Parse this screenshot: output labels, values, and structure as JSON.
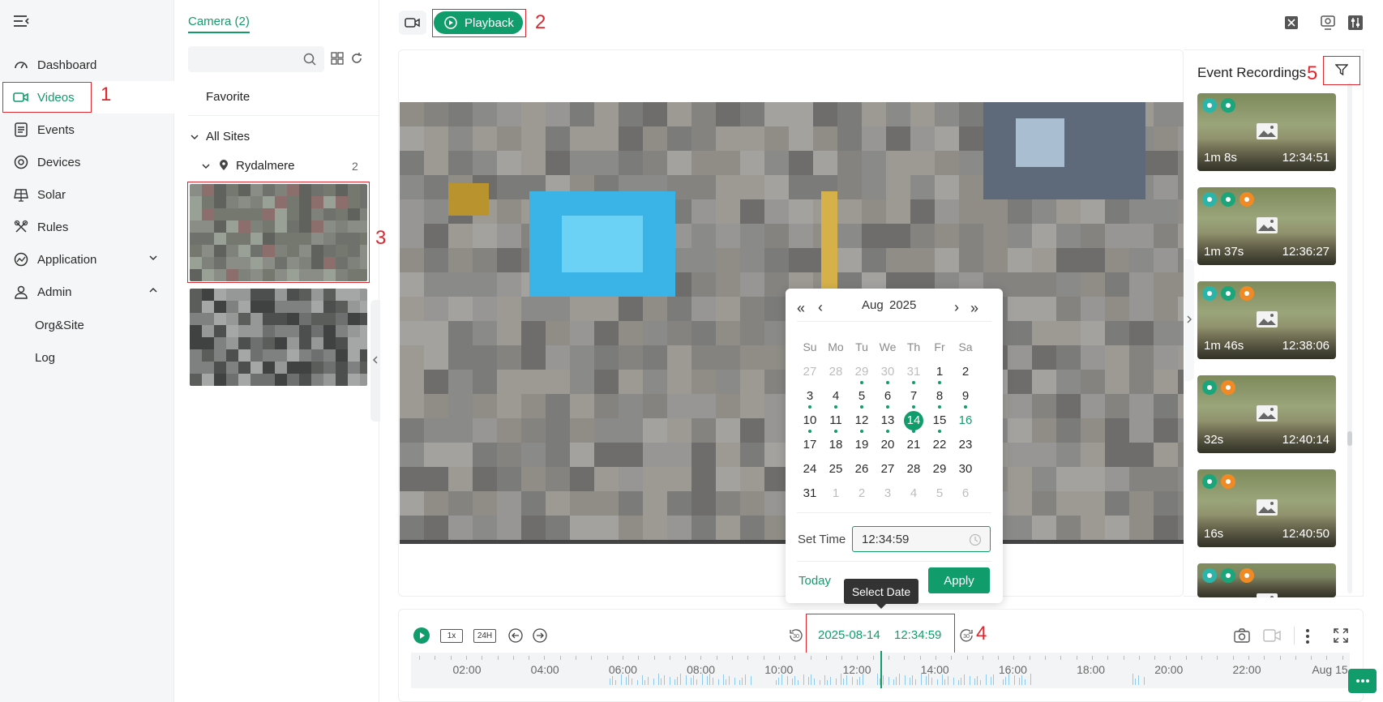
{
  "sidebar": {
    "items": [
      {
        "label": "Dashboard"
      },
      {
        "label": "Videos"
      },
      {
        "label": "Events"
      },
      {
        "label": "Devices"
      },
      {
        "label": "Solar"
      },
      {
        "label": "Rules"
      },
      {
        "label": "Application"
      },
      {
        "label": "Admin"
      }
    ],
    "sub_items": [
      {
        "label": "Org&Site"
      },
      {
        "label": "Log"
      }
    ]
  },
  "camera_panel": {
    "tab_label": "Camera (2)",
    "search_placeholder": "",
    "favorite_label": "Favorite",
    "all_sites_label": "All Sites",
    "site": {
      "name": "Rydalmere",
      "count": "2"
    }
  },
  "topbar": {
    "playback_label": "Playback"
  },
  "annotations": [
    "1",
    "2",
    "3",
    "4",
    "5"
  ],
  "events": {
    "title": "Event Recordings",
    "items": [
      {
        "duration": "1m 8s",
        "time": "12:34:51",
        "badges": [
          "vehicle",
          "person-running"
        ]
      },
      {
        "duration": "1m 37s",
        "time": "12:36:27",
        "badges": [
          "vehicle",
          "person-running",
          "person"
        ]
      },
      {
        "duration": "1m 46s",
        "time": "12:38:06",
        "badges": [
          "vehicle",
          "person-running",
          "person"
        ]
      },
      {
        "duration": "32s",
        "time": "12:40:14",
        "badges": [
          "person-running",
          "person"
        ]
      },
      {
        "duration": "16s",
        "time": "12:40:50",
        "badges": [
          "person-running",
          "person"
        ]
      },
      {
        "duration": "",
        "time": "",
        "badges": [
          "vehicle",
          "person-running",
          "person"
        ]
      }
    ]
  },
  "calendar": {
    "month_label": "Aug",
    "year_label": "2025",
    "weekdays": [
      "Su",
      "Mo",
      "Tu",
      "We",
      "Th",
      "Fr",
      "Sa"
    ],
    "weeks": [
      [
        "27",
        "28",
        "29",
        "30",
        "31",
        "1",
        "2"
      ],
      [
        "3",
        "4",
        "5",
        "6",
        "7",
        "8",
        "9"
      ],
      [
        "10",
        "11",
        "12",
        "13",
        "14",
        "15",
        "16"
      ],
      [
        "17",
        "18",
        "19",
        "20",
        "21",
        "22",
        "23"
      ],
      [
        "24",
        "25",
        "26",
        "27",
        "28",
        "29",
        "30"
      ],
      [
        "31",
        "1",
        "2",
        "3",
        "4",
        "5",
        "6"
      ]
    ],
    "selected_day": "14",
    "set_time_label": "Set Time",
    "time_value": "12:34:59",
    "today_label": "Today",
    "apply_label": "Apply"
  },
  "tooltip": "Select Date",
  "timeline": {
    "date": "2025-08-14",
    "time": "12:34:59",
    "speed_label": "1x",
    "mode_label": "24H",
    "tick_labels": [
      "02:00",
      "04:00",
      "06:00",
      "08:00",
      "10:00",
      "12:00",
      "14:00",
      "16:00",
      "18:00",
      "20:00",
      "22:00",
      "Aug 15"
    ]
  },
  "colors": {
    "accent": "#119c6b",
    "annotation": "#e0262e",
    "person_badge": "#f08a24",
    "vehicle_badge": "#2bb5a9"
  }
}
